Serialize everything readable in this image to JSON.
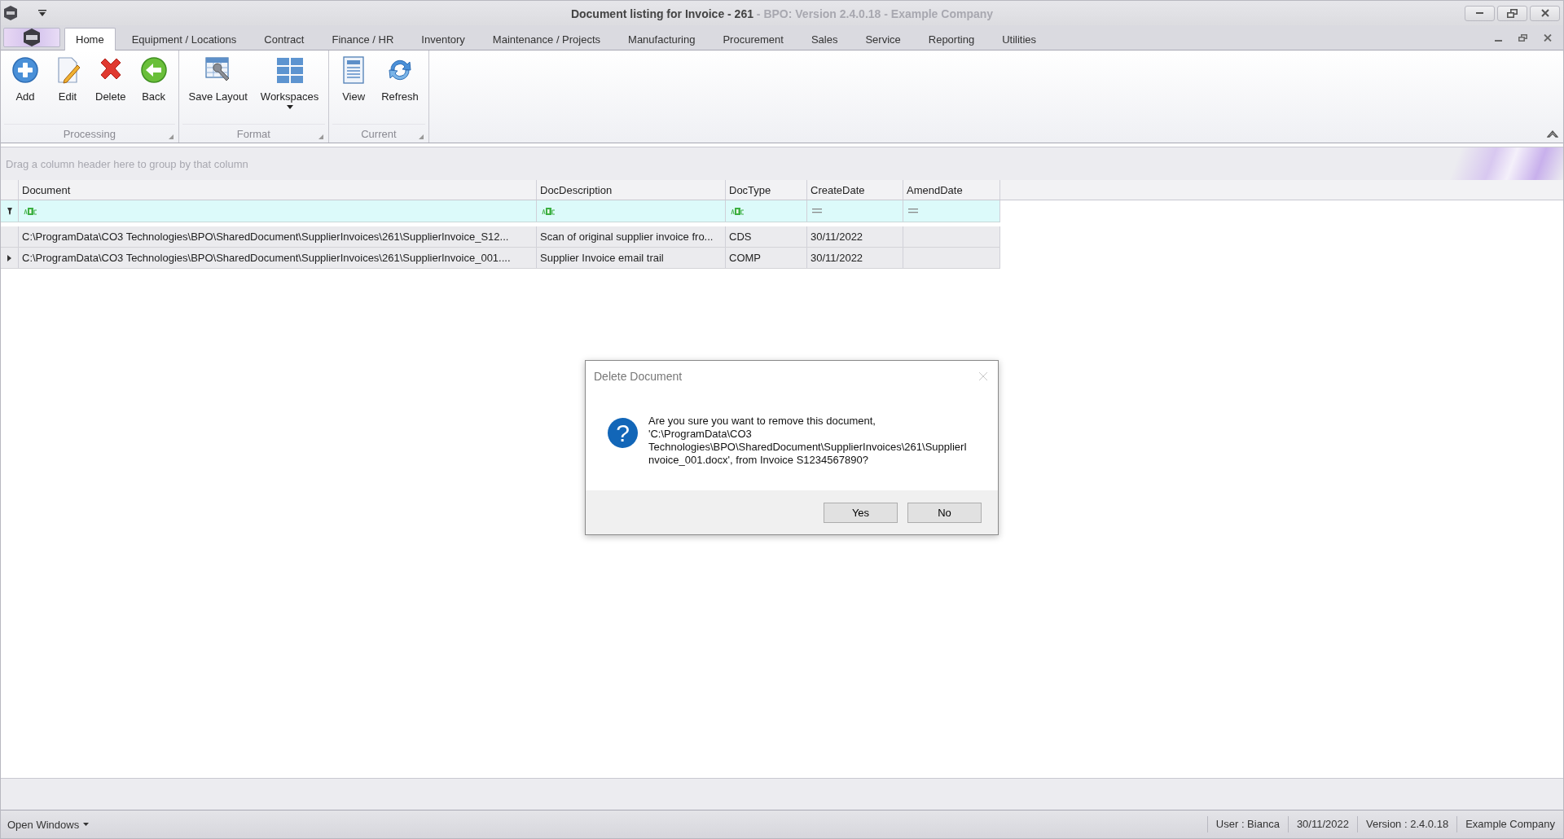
{
  "window": {
    "title": "Document listing for Invoice - 261",
    "subtitle": "- BPO: Version 2.4.0.18 - Example Company"
  },
  "tabs": [
    {
      "label": "Home",
      "selected": true
    },
    {
      "label": "Equipment / Locations",
      "selected": false
    },
    {
      "label": "Contract",
      "selected": false
    },
    {
      "label": "Finance / HR",
      "selected": false
    },
    {
      "label": "Inventory",
      "selected": false
    },
    {
      "label": "Maintenance / Projects",
      "selected": false
    },
    {
      "label": "Manufacturing",
      "selected": false
    },
    {
      "label": "Procurement",
      "selected": false
    },
    {
      "label": "Sales",
      "selected": false
    },
    {
      "label": "Service",
      "selected": false
    },
    {
      "label": "Reporting",
      "selected": false
    },
    {
      "label": "Utilities",
      "selected": false
    }
  ],
  "ribbon_groups": [
    {
      "label": "Processing",
      "buttons": [
        {
          "label": "Add",
          "kind": "add"
        },
        {
          "label": "Edit",
          "kind": "edit"
        },
        {
          "label": "Delete",
          "kind": "delete"
        },
        {
          "label": "Back",
          "kind": "back"
        }
      ]
    },
    {
      "label": "Format",
      "buttons": [
        {
          "label": "Save Layout",
          "kind": "layout"
        },
        {
          "label": "Workspaces",
          "kind": "workspaces",
          "dropdown": true
        }
      ]
    },
    {
      "label": "Current",
      "buttons": [
        {
          "label": "View",
          "kind": "view"
        },
        {
          "label": "Refresh",
          "kind": "refresh"
        }
      ]
    }
  ],
  "group_panel": {
    "hint": "Drag a column header here to group by that column"
  },
  "grid": {
    "columns": [
      {
        "label": "Document",
        "kind": "text"
      },
      {
        "label": "DocDescription",
        "kind": "text"
      },
      {
        "label": "DocType",
        "kind": "text"
      },
      {
        "label": "CreateDate",
        "kind": "date"
      },
      {
        "label": "AmendDate",
        "kind": "date"
      }
    ],
    "rows": [
      {
        "focused": false,
        "cells": [
          "C:\\ProgramData\\CO3 Technologies\\BPO\\SharedDocument\\SupplierInvoices\\261\\SupplierInvoice_S12...",
          "Scan of original supplier invoice fro...",
          "CDS",
          "30/11/2022"
        ]
      },
      {
        "focused": true,
        "cells": [
          "C:\\ProgramData\\CO3 Technologies\\BPO\\SharedDocument\\SupplierInvoices\\261\\SupplierInvoice_001....",
          "Supplier Invoice email trail",
          "COMP",
          "30/11/2022"
        ]
      }
    ]
  },
  "dialog": {
    "title": "Delete Document",
    "icon_glyph": "?",
    "message": "Are you sure you want to remove this document, 'C:\\ProgramData\\CO3 Technologies\\BPO\\SharedDocument\\SupplierInvoices\\261\\SupplierInvoice_001.docx', from Invoice S1234567890?",
    "buttons": [
      "Yes",
      "No"
    ]
  },
  "status_bar": {
    "left": "Open Windows",
    "right": [
      "User : Bianca",
      "30/11/2022",
      "Version : 2.4.0.18",
      "Example Company"
    ]
  }
}
